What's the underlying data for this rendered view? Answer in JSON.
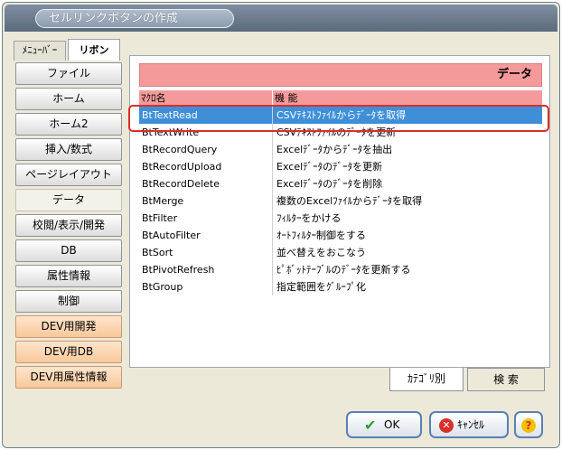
{
  "window": {
    "title": "セルリンクボタンの作成"
  },
  "top_tabs": [
    {
      "label": "ﾒﾆｭｰﾊﾞｰ"
    },
    {
      "label": "リボン"
    }
  ],
  "nav": [
    {
      "label": "ファイル"
    },
    {
      "label": "ホーム"
    },
    {
      "label": "ホーム2"
    },
    {
      "label": "挿入/数式"
    },
    {
      "label": "ページレイアウト"
    },
    {
      "label": "データ"
    },
    {
      "label": "校閲/表示/開発"
    },
    {
      "label": "DB"
    },
    {
      "label": "属性情報"
    },
    {
      "label": "制御"
    },
    {
      "label": "DEV用開発"
    },
    {
      "label": "DEV用DB"
    },
    {
      "label": "DEV用属性情報"
    }
  ],
  "panel": {
    "header": "データ",
    "columns": {
      "name": "ﾏｸﾛ名",
      "function": "機 能"
    },
    "rows": [
      {
        "name": "BtTextRead",
        "function": "CSVﾃｷｽﾄﾌｧｲﾙからﾃﾞｰﾀを取得"
      },
      {
        "name": "BtTextWrite",
        "function": "CSVﾃｷｽﾄﾌｧｲﾙのﾃﾞｰﾀを更新"
      },
      {
        "name": "BtRecordQuery",
        "function": "Excelﾃﾞｰﾀからﾃﾞｰﾀを抽出"
      },
      {
        "name": "BtRecordUpload",
        "function": "Excelﾃﾞｰﾀのﾃﾞｰﾀを更新"
      },
      {
        "name": "BtRecordDelete",
        "function": "Excelﾃﾞｰﾀのﾃﾞｰﾀを削除"
      },
      {
        "name": "BtMerge",
        "function": "複数のExcelﾌｧｲﾙからﾃﾞｰﾀを取得"
      },
      {
        "name": "BtFilter",
        "function": "ﾌｨﾙﾀｰをかける"
      },
      {
        "name": "BtAutoFilter",
        "function": "ｵｰﾄﾌｨﾙﾀｰ制御をする"
      },
      {
        "name": "BtSort",
        "function": "並べ替えをおこなう"
      },
      {
        "name": "BtPivotRefresh",
        "function": "ﾋﾟﾎﾞｯﾄﾃｰﾌﾞﾙのﾃﾞｰﾀを更新する"
      },
      {
        "name": "BtGroup",
        "function": "指定範囲をｸﾞﾙｰﾌﾟ化"
      }
    ]
  },
  "bottom_tabs": [
    {
      "label": "ｶﾃｺﾞﾘ別"
    },
    {
      "label": "検 索"
    }
  ],
  "buttons": {
    "ok": "OK",
    "cancel": "ｷｬﾝｾﾙ",
    "help": "?"
  },
  "colors": {
    "accent_header": "#f49a9a",
    "selection": "#3f8fd8",
    "dev_button": "#f8c89b",
    "highlight_outline": "#d9302a"
  }
}
